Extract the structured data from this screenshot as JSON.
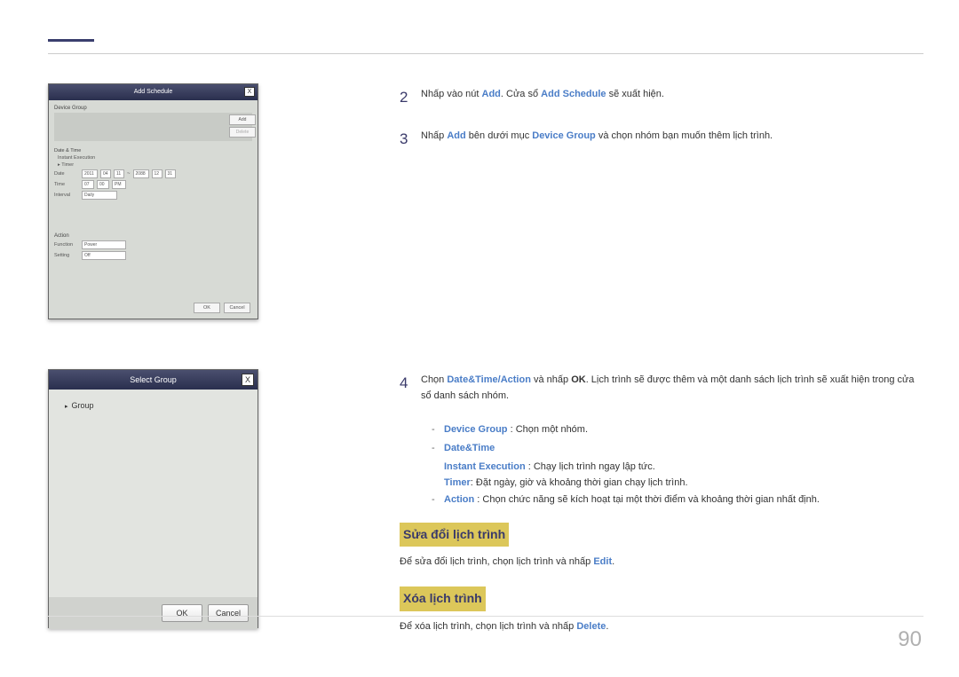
{
  "pageNumber": "90",
  "screenshot1": {
    "title": "Add Schedule",
    "deviceGroupLabel": "Device Group",
    "addBtn": "Add",
    "deleteBtn": "Delete",
    "dateTimeLabel": "Date & Time",
    "instantExecLabel": "Instant Execution",
    "timerLabel": "Timer",
    "dateLabel": "Date",
    "dateVals": [
      "2011",
      "04",
      "11",
      "~",
      "2088",
      "12",
      "31"
    ],
    "timeLabel": "Time",
    "timeVals": [
      "07",
      "00",
      "PM"
    ],
    "intervalLabel": "Interval",
    "intervalVal": "Daily",
    "actionLabel": "Action",
    "functionLabel": "Function",
    "functionVal": "Power",
    "settingLabel": "Setting",
    "settingVal": "Off",
    "okBtn": "OK",
    "cancelBtn": "Cancel"
  },
  "screenshot2": {
    "title": "Select Group",
    "groupItem": "Group",
    "okBtn": "OK",
    "cancelBtn": "Cancel"
  },
  "steps": {
    "s2": {
      "num": "2",
      "t1": "Nhấp vào nút ",
      "addLink": "Add",
      "t2": ". Cửa sổ ",
      "addSchedLink": "Add Schedule",
      "t3": " sẽ xuất hiện."
    },
    "s3": {
      "num": "3",
      "t1": "Nhấp ",
      "addLink": "Add",
      "t2": " bên dưới mục ",
      "dgLink": "Device Group",
      "t3": " và chọn nhóm bạn muốn thêm lịch trình."
    },
    "s4": {
      "num": "4",
      "t1": "Chọn ",
      "dtLink": "Date&Time",
      "slash": "/",
      "actLink": "Action",
      "t2": " và nhấp ",
      "okBold": "OK",
      "t3": ". Lịch trình sẽ được thêm và một danh sách lịch trình sẽ xuất hiện trong cửa sổ danh sách nhóm."
    }
  },
  "subitems": {
    "dg": {
      "label": "Device Group",
      "text": " : Chọn một nhóm."
    },
    "dt": {
      "label": "Date&Time"
    },
    "ie": {
      "label": "Instant Execution",
      "text": " : Chạy lịch trình ngay lập tức."
    },
    "timer": {
      "label": "Timer",
      "text": ": Đặt ngày, giờ và khoảng thời gian chạy lịch trình."
    },
    "action": {
      "label": "Action",
      "text": " : Chọn chức năng sẽ kích hoạt tại một thời điểm và khoảng thời gian nhất định."
    }
  },
  "editSection": {
    "heading": "Sửa đổi lịch trình",
    "t1": "Để sửa đổi lịch trình, chọn lịch trình và nhấp ",
    "editLink": "Edit",
    "t2": "."
  },
  "deleteSection": {
    "heading": "Xóa lịch trình",
    "t1": "Để xóa lịch trình, chọn lịch trình và nhấp ",
    "delLink": "Delete",
    "t2": "."
  }
}
